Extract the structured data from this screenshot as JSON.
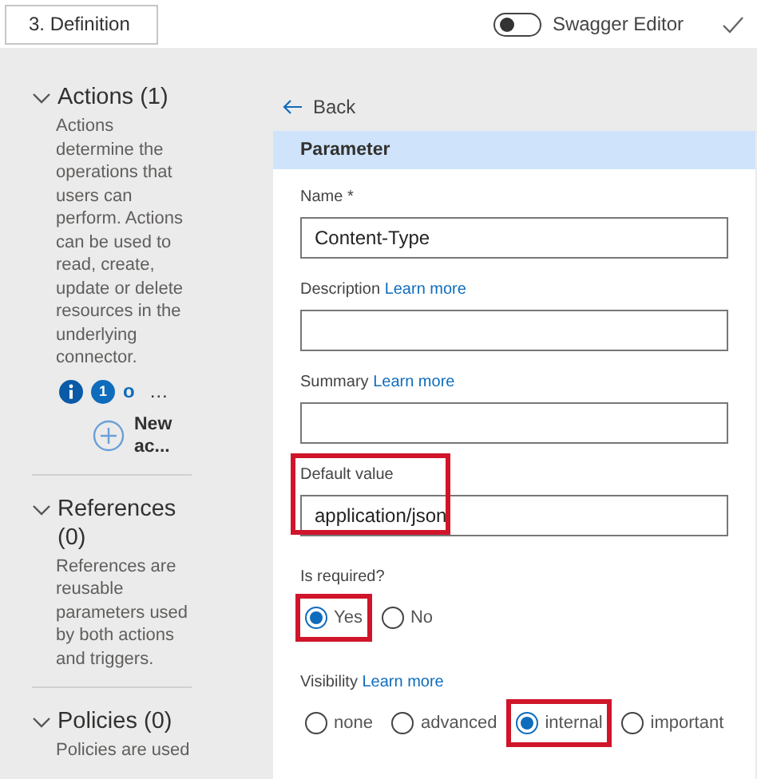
{
  "header": {
    "step_dropdown": "3. Definition",
    "swagger_editor": {
      "label": "Swagger Editor",
      "on": false
    }
  },
  "sidebar": {
    "sections": [
      {
        "title": "Actions (1)",
        "expanded": true,
        "description": "Actions determine the operations that users can perform. Actions can be used to read, create, update or delete resources in the underlying connector.",
        "operation": {
          "badge": "1",
          "name": "o",
          "more": "…"
        },
        "new_button": "New ac..."
      },
      {
        "title": "References (0)",
        "expanded": true,
        "description": "References are reusable parameters used by both actions and triggers."
      },
      {
        "title": "Policies (0)",
        "expanded": true,
        "description": "Policies are used"
      }
    ]
  },
  "editor": {
    "back": "Back",
    "panel_title": "Parameter",
    "fields": [
      {
        "label": "Name",
        "required_mark": "*",
        "value": "Content-Type",
        "highlighted": false
      },
      {
        "label": "Description",
        "learn_more": "Learn more",
        "highlighted": false
      },
      {
        "label": "Summary",
        "learn_more": "Learn more",
        "highlighted": false
      },
      {
        "label": "Default value",
        "value": "application/json",
        "highlighted": true
      }
    ],
    "radio_groups": [
      {
        "label": "Is required?",
        "options": [
          {
            "label": "Yes",
            "selected": true,
            "highlighted": true
          },
          {
            "label": "No",
            "selected": false,
            "highlighted": false
          }
        ]
      },
      {
        "label": "Visibility",
        "learn_more": "Learn more",
        "options": [
          {
            "label": "none",
            "selected": false,
            "highlighted": false
          },
          {
            "label": "advanced",
            "selected": false,
            "highlighted": false
          },
          {
            "label": "internal",
            "selected": true,
            "highlighted": true
          },
          {
            "label": "important",
            "selected": false,
            "highlighted": false
          }
        ]
      }
    ]
  }
}
